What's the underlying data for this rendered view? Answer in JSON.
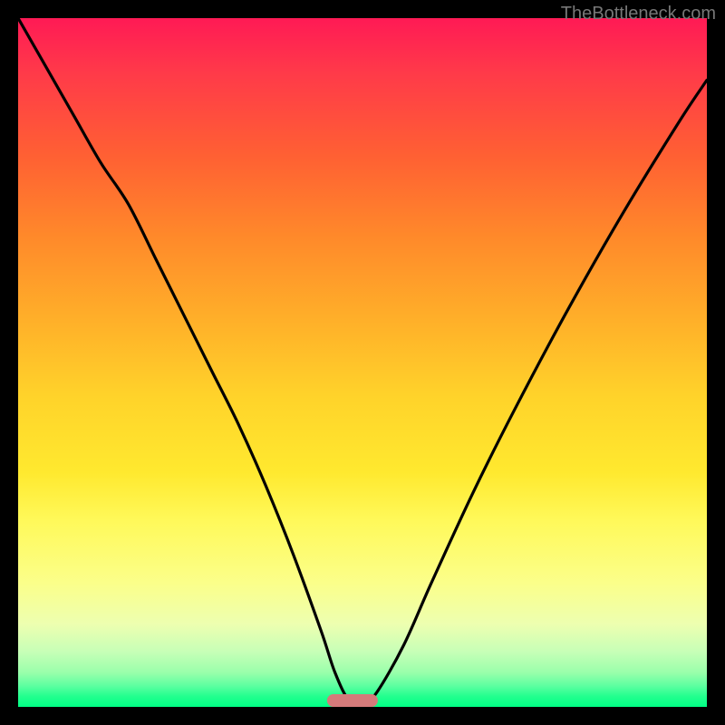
{
  "watermark": "TheBottleneck.com",
  "chart_data": {
    "type": "line",
    "title": "",
    "xlabel": "",
    "ylabel": "",
    "xlim": [
      0,
      100
    ],
    "ylim": [
      0,
      100
    ],
    "grid": false,
    "legend": false,
    "description": "Bottleneck percentage curve. Y axis encoded as vertical rainbow gradient (red=top=high bottleneck, green=bottom=0% bottleneck). Single black curve descending from top-left, reaching minimum around x≈48, then rising toward top-right. A rounded marker sits at the minimum on the baseline.",
    "series": [
      {
        "name": "bottleneck-curve",
        "x": [
          0,
          4,
          8,
          12,
          16,
          20,
          24,
          28,
          32,
          36,
          40,
          44,
          46,
          48,
          50,
          52,
          56,
          60,
          66,
          72,
          80,
          88,
          96,
          100
        ],
        "y": [
          100,
          93,
          86,
          79,
          73,
          65,
          57,
          49,
          41,
          32,
          22,
          11,
          5,
          1,
          0.5,
          2,
          9,
          18,
          31,
          43,
          58,
          72,
          85,
          91
        ]
      }
    ],
    "marker": {
      "x": 48.5,
      "width_pct": 7.4
    },
    "gradient_stops": [
      {
        "pct": 0,
        "color": "#ff1a55"
      },
      {
        "pct": 50,
        "color": "#ffd32a"
      },
      {
        "pct": 100,
        "color": "#00ff85"
      }
    ]
  }
}
